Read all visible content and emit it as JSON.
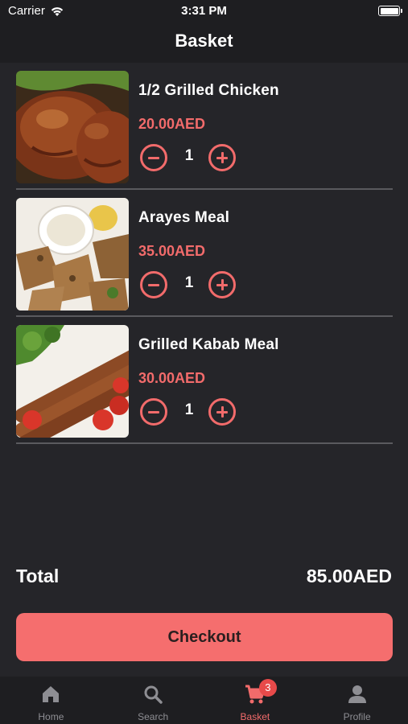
{
  "status_bar": {
    "carrier": "Carrier",
    "time": "3:31 PM"
  },
  "nav": {
    "title": "Basket"
  },
  "items": [
    {
      "name": "1/2 Grilled Chicken",
      "price": "20.00AED",
      "quantity": "1",
      "image": "grilled-chicken-photo"
    },
    {
      "name": "Arayes Meal",
      "price": "35.00AED",
      "quantity": "1",
      "image": "arayes-meal-photo"
    },
    {
      "name": "Grilled Kabab Meal",
      "price": "30.00AED",
      "quantity": "1",
      "image": "kabab-meal-photo"
    }
  ],
  "total": {
    "label": "Total",
    "value": "85.00AED"
  },
  "checkout": {
    "label": "Checkout"
  },
  "tabs": [
    {
      "label": "Home",
      "icon": "home-icon",
      "active": false
    },
    {
      "label": "Search",
      "icon": "search-icon",
      "active": false
    },
    {
      "label": "Basket",
      "icon": "cart-icon",
      "active": true,
      "badge": "3"
    },
    {
      "label": "Profile",
      "icon": "person-icon",
      "active": false
    }
  ],
  "colors": {
    "accent": "#f26b6b",
    "button": "#f56e6e",
    "background": "#252529",
    "bar": "#1e1e21"
  }
}
